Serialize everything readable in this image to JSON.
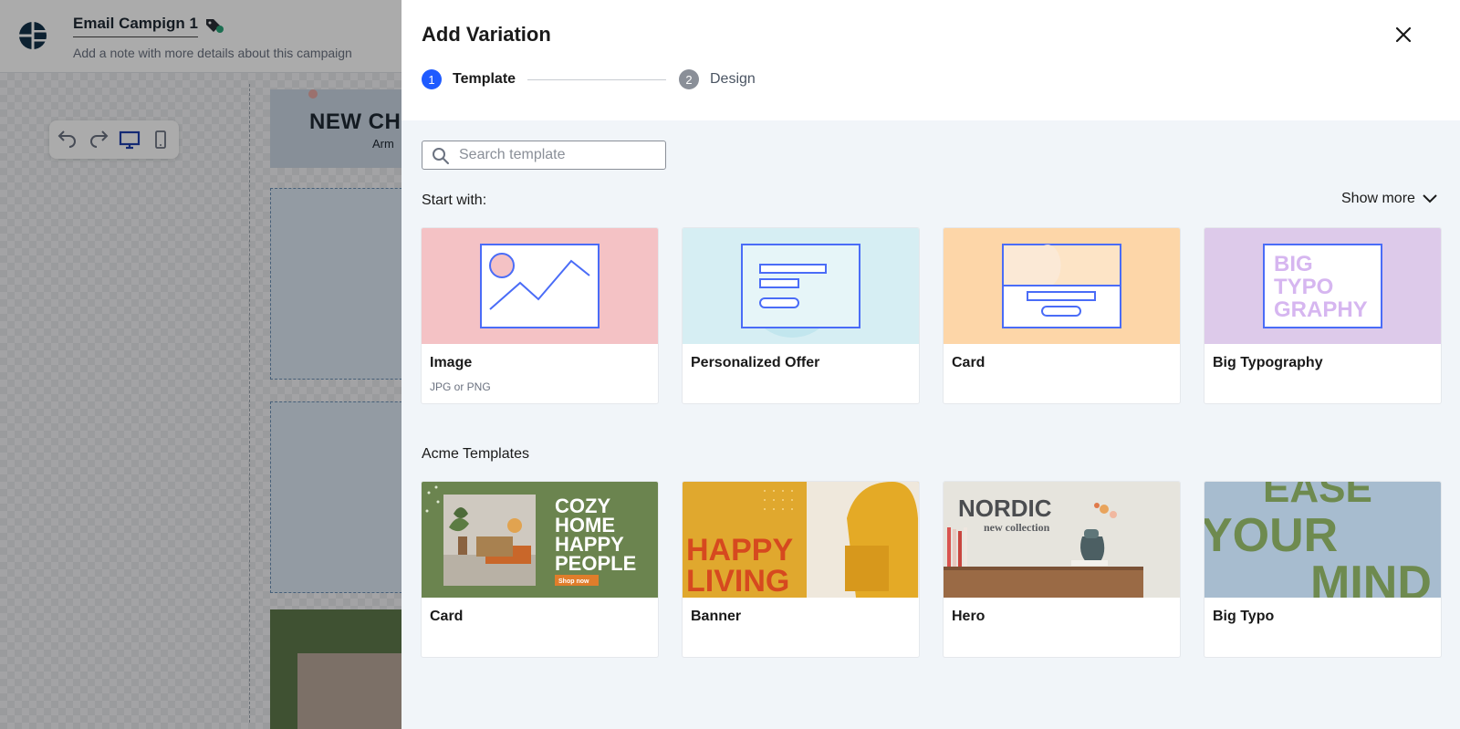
{
  "app": {
    "campaign_title": "Email Campign 1",
    "campaign_note": "Add a note with more details about this campaign",
    "email_preview": {
      "banner_title": "NEW CH",
      "banner_sub": "Arm"
    }
  },
  "drawer": {
    "title": "Add Variation",
    "steps": [
      {
        "number": "1",
        "label": "Template",
        "active": true
      },
      {
        "number": "2",
        "label": "Design",
        "active": false
      }
    ],
    "search": {
      "placeholder": "Search template",
      "value": ""
    },
    "start_with": {
      "label": "Start with:",
      "show_more": "Show more",
      "items": [
        {
          "name": "Image",
          "subtitle": "JPG or PNG",
          "bg": "#f4c2c5"
        },
        {
          "name": "Personalized Offer",
          "subtitle": "",
          "bg": "#d6eef3"
        },
        {
          "name": "Card",
          "subtitle": "",
          "bg": "#fdd6a8"
        },
        {
          "name": "Big Typography",
          "subtitle": "",
          "bg": "#ddcaea",
          "thumb_text": [
            "BIG",
            "TYPO",
            "GRAPHY"
          ]
        }
      ]
    },
    "acme": {
      "label": "Acme Templates",
      "items": [
        {
          "name": "Card",
          "thumb_text": [
            "COZY",
            "HOME",
            "HAPPY",
            "PEOPLE"
          ],
          "thumb_button": "Shop now"
        },
        {
          "name": "Banner",
          "thumb_text": [
            "HAPPY",
            "LIVING"
          ]
        },
        {
          "name": "Hero",
          "thumb_text": [
            "NORDIC",
            "new collection"
          ]
        },
        {
          "name": "Big Typo",
          "thumb_text": [
            "EASE",
            "YOUR",
            "MIND"
          ]
        }
      ]
    }
  },
  "colors": {
    "accent": "#1f5bff",
    "outline_blue": "#4a6cf7"
  }
}
